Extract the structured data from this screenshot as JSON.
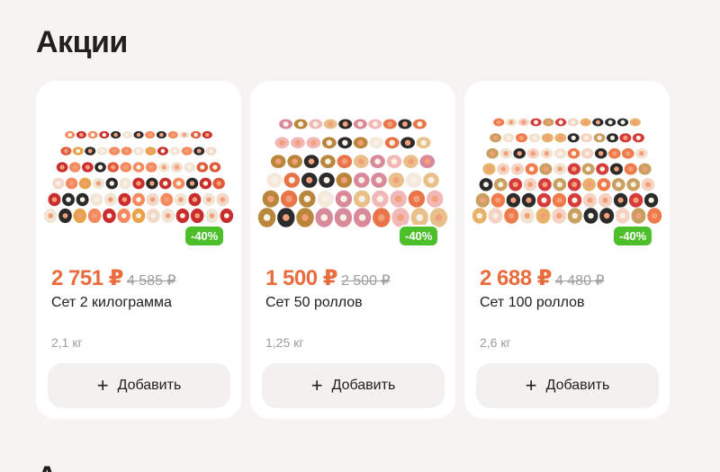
{
  "section": {
    "title": "Акции"
  },
  "products": [
    {
      "name": "Сет 2 килограмма",
      "price": "2 751 ₽",
      "old_price": "4 585 ₽",
      "discount": "-40%",
      "weight": "2,1 кг",
      "add_label": "Добавить",
      "add_icon": "plus-icon",
      "plus": "+"
    },
    {
      "name": "Сет 50 роллов",
      "price": "1 500 ₽",
      "old_price": "2 500 ₽",
      "discount": "-40%",
      "weight": "1,25 кг",
      "add_label": "Добавить",
      "add_icon": "plus-icon",
      "plus": "+"
    },
    {
      "name": "Сет 100 роллов",
      "price": "2 688 ₽",
      "old_price": "4 480 ₽",
      "discount": "-40%",
      "weight": "2,6 кг",
      "add_label": "Добавить",
      "add_icon": "plus-icon",
      "plus": "+"
    }
  ],
  "next_section": {
    "title": "А"
  },
  "colors": {
    "accent_price": "#ea6b3b",
    "discount_badge": "#4cbf2b",
    "background": "#f5f4f2"
  }
}
